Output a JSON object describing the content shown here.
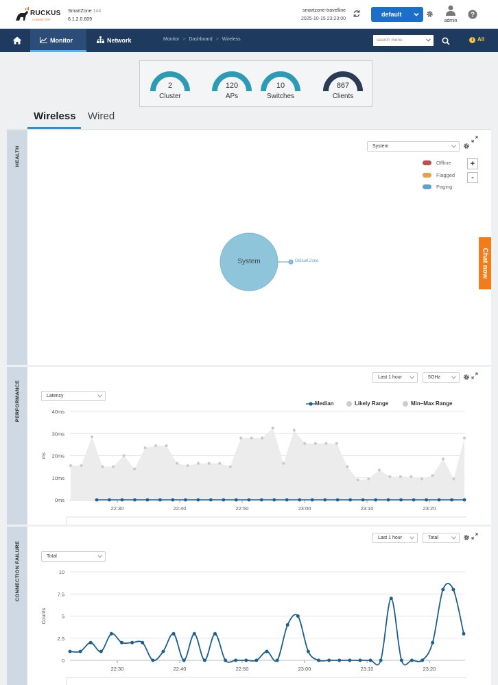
{
  "header": {
    "logo_text": "RUCKUS",
    "logo_sub": "COMMSCOPE",
    "product_name": "SmartZone",
    "product_model": "144",
    "product_version": "6.1.2.0.609",
    "system_name": "smartzone-travelline",
    "system_time": "2025-10-15  23:23:00",
    "domain_label": "default",
    "user_label": "admin"
  },
  "nav": {
    "tabs": [
      {
        "label": "Monitor"
      },
      {
        "label": "Network"
      }
    ],
    "breadcrumb": [
      "Monitor",
      "Dashboard",
      "Wireless"
    ],
    "search_placeholder": "search menu",
    "alert_label": "All"
  },
  "summary": {
    "stats": [
      {
        "value": "2",
        "label": "Cluster",
        "color": "#2e9bb5"
      },
      {
        "value": "120",
        "label": "APs",
        "color": "#2e9bb5"
      },
      {
        "value": "10",
        "label": "Switches",
        "color": "#2e9bb5"
      },
      {
        "value": "867",
        "label": "Clients",
        "color": "#2b3a55"
      }
    ]
  },
  "subtabs": [
    "Wireless",
    "Wired"
  ],
  "health": {
    "side_label": "HEALTH",
    "select_value": "System",
    "legend": [
      {
        "label": "Offline",
        "color": "#c0504d"
      },
      {
        "label": "Flagged",
        "color": "#e8a04a"
      },
      {
        "label": "Paging",
        "color": "#5ba2cf"
      }
    ],
    "zoom_in": "+",
    "zoom_out": "-",
    "root_node": "System",
    "child_node": "Default Zone"
  },
  "performance": {
    "side_label": "PERFORMANCE",
    "time_select": "Last 1 hour",
    "band_select": "5GHz",
    "metric_select": "Latency",
    "legend": [
      "Median",
      "Likely Range",
      "Min–Max Range"
    ]
  },
  "connection_failure": {
    "side_label": "CONNECTION FAILURE",
    "time_select": "Last 1 hour",
    "type_select": "Total"
  },
  "chat_label": "Chat now",
  "chart_data": [
    {
      "type": "area",
      "title": "",
      "ylabel": "ms",
      "yticks": [
        "0ms",
        "10ms",
        "20ms",
        "30ms",
        "40ms"
      ],
      "ylim": [
        0,
        40
      ],
      "x_ticks": [
        "22:30",
        "22:40",
        "22:50",
        "23:00",
        "23:10",
        "23:20"
      ],
      "x_minutes": [
        22,
        24,
        26,
        28,
        30,
        32,
        34,
        36,
        38,
        40,
        42,
        44,
        46,
        48,
        50,
        52,
        54,
        56,
        58,
        60,
        62,
        64,
        66,
        68,
        70,
        72,
        74,
        76,
        78,
        80
      ],
      "series": [
        {
          "name": "Median",
          "color": "#1d5f8f",
          "values": [
            0,
            0,
            0,
            0,
            0,
            0,
            0,
            0,
            0,
            0,
            0,
            0,
            0,
            0,
            0,
            0,
            0,
            0,
            0,
            0,
            0,
            0,
            0,
            0,
            0,
            0,
            0,
            0,
            0,
            0
          ]
        },
        {
          "name": "Min–Max Range",
          "color": "#cccccc",
          "values": [
            15.5,
            15.5,
            28.5,
            15,
            15,
            20,
            14,
            23.5,
            24.5,
            24.5,
            16.5,
            15.5,
            16.5,
            16.5,
            16.5,
            15,
            28,
            28,
            28,
            32.5,
            16.5,
            31.5,
            25.5,
            25.5,
            25.5,
            25.5,
            15,
            9,
            9.5,
            13.5,
            10.5,
            10.5,
            10.5,
            9.5,
            11,
            18.5,
            9.5,
            28
          ]
        }
      ]
    },
    {
      "type": "line",
      "title": "",
      "ylabel": "Counts",
      "yticks": [
        "0",
        "2.5",
        "5",
        "7.5",
        "10"
      ],
      "ylim": [
        0,
        10
      ],
      "x_ticks": [
        "22:30",
        "22:40",
        "22:50",
        "23:00",
        "23:10",
        "23:20"
      ],
      "series": [
        {
          "name": "",
          "color": "#1d5f8f",
          "values": [
            1,
            1,
            2,
            1,
            3,
            2,
            2,
            2,
            0,
            1,
            3,
            0,
            3,
            0,
            3,
            0,
            0,
            0,
            0,
            1,
            0,
            4,
            5,
            1,
            0,
            0,
            0,
            0,
            0,
            0,
            0,
            7,
            0,
            0,
            0,
            2,
            8,
            8,
            3
          ]
        }
      ]
    }
  ]
}
